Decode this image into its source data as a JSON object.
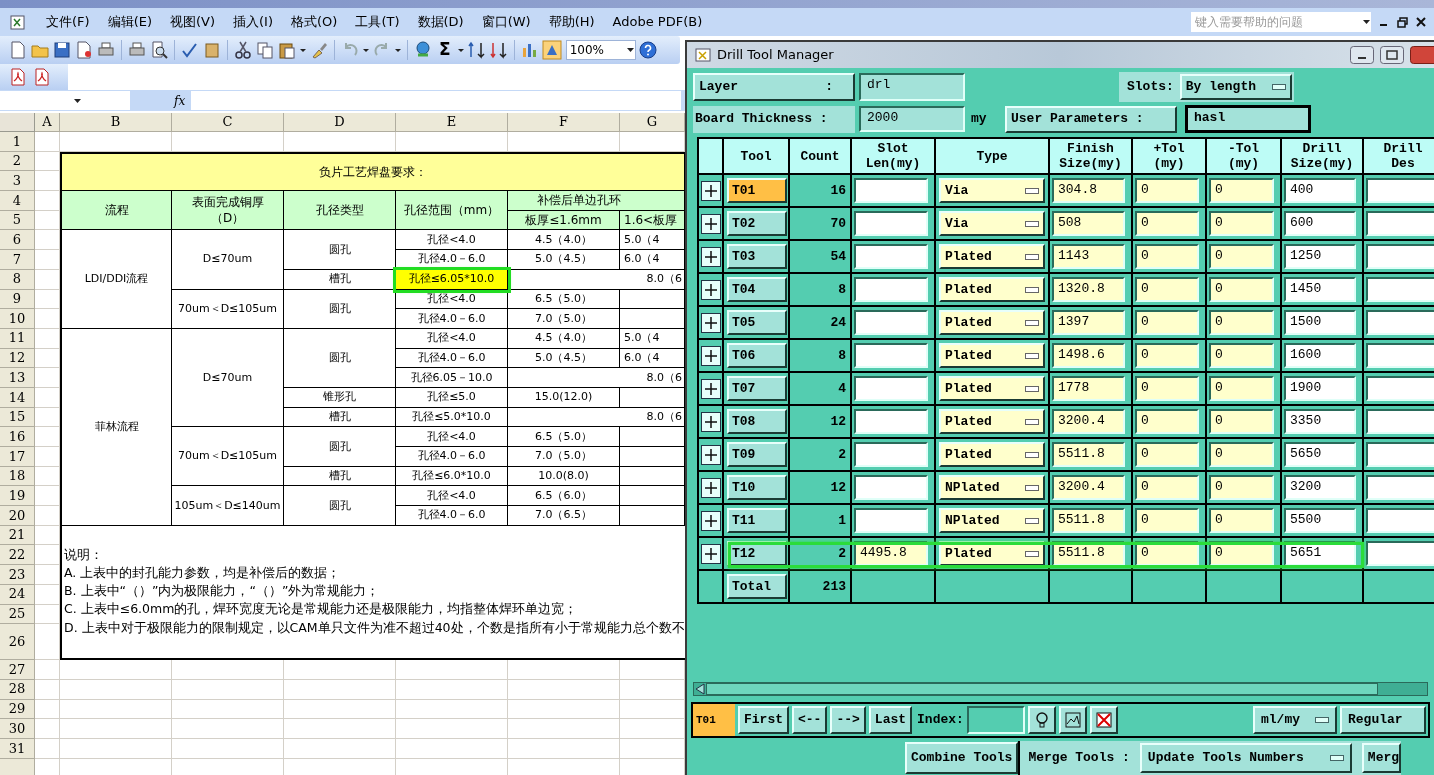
{
  "excel": {
    "menu": [
      "文件(F)",
      "编辑(E)",
      "视图(V)",
      "插入(I)",
      "格式(O)",
      "工具(T)",
      "数据(D)",
      "窗口(W)",
      "帮助(H)",
      "Adobe PDF(B)"
    ],
    "help_placeholder": "键入需要帮助的问题",
    "sigma": "Σ",
    "zoom": "100%",
    "formula_label": "fx",
    "column_headers": [
      "A",
      "B",
      "C",
      "D",
      "E",
      "F",
      "G"
    ],
    "row_headers": [
      "1",
      "2",
      "3",
      "4",
      "5",
      "6",
      "7",
      "8",
      "9",
      "10",
      "11",
      "12",
      "13",
      "14",
      "15",
      "16",
      "17",
      "18",
      "19",
      "20",
      "21",
      "22",
      "23",
      "24",
      "25",
      "26",
      "27",
      "28",
      "29",
      "30",
      "31"
    ],
    "cells": [
      {
        "text": "负片工艺焊盘要求：",
        "highlighted": false
      },
      {
        "text": "流程",
        "highlighted": false
      },
      {
        "text": "表面完成铜厚（D）",
        "highlighted": false
      },
      {
        "text": "孔径类型",
        "highlighted": false
      },
      {
        "text": "孔径范围（mm）",
        "highlighted": false
      },
      {
        "text": "补偿后单边孔环",
        "highlighted": false
      },
      {
        "text": "板厚≤1.6mm",
        "highlighted": false
      },
      {
        "text": "1.6<板厚",
        "highlighted": false
      },
      {
        "text": "LDI/DDI流程",
        "highlighted": false
      },
      {
        "text": "D≤70um",
        "highlighted": false
      },
      {
        "text": "圆孔",
        "highlighted": false
      },
      {
        "text": "孔径<4.0",
        "highlighted": false
      },
      {
        "text": "4.5（4.0）",
        "highlighted": false
      },
      {
        "text": "5.0（4",
        "highlighted": false
      },
      {
        "text": "孔径4.0－6.0",
        "highlighted": false
      },
      {
        "text": "5.0（4.5）",
        "highlighted": false
      },
      {
        "text": "6.0（4",
        "highlighted": false
      },
      {
        "text": "槽孔",
        "highlighted": false
      },
      {
        "text": "孔径≤6.05*10.0",
        "highlighted": true
      },
      {
        "text": "8.0（6",
        "highlighted": false
      },
      {
        "text": "70um＜D≤105um",
        "highlighted": false
      },
      {
        "text": "圆孔",
        "highlighted": false
      },
      {
        "text": "孔径<4.0",
        "highlighted": false
      },
      {
        "text": "6.5（5.0）",
        "highlighted": false
      },
      {
        "text": "孔径4.0－6.0",
        "highlighted": false
      },
      {
        "text": "7.0（5.0）",
        "highlighted": false
      },
      {
        "text": "菲林流程",
        "highlighted": false
      },
      {
        "text": "D≤70um",
        "highlighted": false
      },
      {
        "text": "圆孔",
        "highlighted": false
      },
      {
        "text": "孔径<4.0",
        "highlighted": false
      },
      {
        "text": "4.5（4.0）",
        "highlighted": false
      },
      {
        "text": "5.0（4",
        "highlighted": false
      },
      {
        "text": "孔径4.0－6.0",
        "highlighted": false
      },
      {
        "text": "5.0（4.5）",
        "highlighted": false
      },
      {
        "text": "6.0（4",
        "highlighted": false
      },
      {
        "text": "孔径6.05－10.0",
        "highlighted": false
      },
      {
        "text": "8.0（6",
        "highlighted": false
      },
      {
        "text": "锥形孔",
        "highlighted": false
      },
      {
        "text": "孔径≤5.0",
        "highlighted": false
      },
      {
        "text": "15.0(12.0)",
        "highlighted": false
      },
      {
        "text": "槽孔",
        "highlighted": false
      },
      {
        "text": "孔径≤5.0*10.0",
        "highlighted": false
      },
      {
        "text": "8.0（6",
        "highlighted": false
      },
      {
        "text": "70um＜D≤105um",
        "highlighted": false
      },
      {
        "text": "圆孔",
        "highlighted": false
      },
      {
        "text": "孔径<4.0",
        "highlighted": false
      },
      {
        "text": "6.5（5.0）",
        "highlighted": false
      },
      {
        "text": "孔径4.0－6.0",
        "highlighted": false
      },
      {
        "text": "7.0（5.0）",
        "highlighted": false
      },
      {
        "text": "槽孔",
        "highlighted": false
      },
      {
        "text": "孔径≤6.0*10.0",
        "highlighted": false
      },
      {
        "text": "10.0(8.0)",
        "highlighted": false
      },
      {
        "text": "105um＜D≤140um",
        "highlighted": false
      },
      {
        "text": "圆孔",
        "highlighted": false
      },
      {
        "text": "孔径<4.0",
        "highlighted": false
      },
      {
        "text": "6.5（6.0）",
        "highlighted": false
      },
      {
        "text": "孔径4.0－6.0",
        "highlighted": false
      },
      {
        "text": "7.0（6.5）",
        "highlighted": false
      }
    ],
    "notes": [
      "说明：",
      "A.  上表中的封孔能力参数，均是补偿后的数据；",
      "B.  上表中“（）”内为极限能力，“（）”外为常规能力；",
      "C.  上表中≤6.0mm的孔，焊环宽度无论是常规能力还是极限能力，均指整体焊环单边宽；",
      "D.  上表中对于极限能力的限制规定，以CAM单只文件为准不超过40处，个数是指所有小于常规能力总个数不"
    ]
  },
  "drill_tool_manager": {
    "title": "Drill Tool Manager",
    "layer_label": "Layer",
    "layer_colon": ":",
    "layer_value": "drl",
    "slots_label": "Slots:",
    "slots_value": "By length",
    "thickness_label": "Board Thickness :",
    "thickness_value": "2000",
    "thickness_unit": "my",
    "user_params_button": "User Parameters :",
    "user_params_value": "hasl",
    "columns": [
      "Tool",
      "Count",
      "Slot\nLen(my)",
      "Type",
      "Finish\nSize(my)",
      "+Tol\n(my)",
      "-Tol\n(my)",
      "Drill\nSize(my)",
      "Drill\nDes"
    ],
    "rows": [
      {
        "tool": "T01",
        "selected": true,
        "count": "16",
        "type": "Via",
        "finish": "304.8",
        "plus_tol": "0",
        "minus_tol": "0",
        "drill_size": "400",
        "highlighted": false
      },
      {
        "tool": "T02",
        "selected": false,
        "count": "70",
        "type": "Via",
        "finish": "508",
        "plus_tol": "0",
        "minus_tol": "0",
        "drill_size": "600",
        "highlighted": false
      },
      {
        "tool": "T03",
        "selected": false,
        "count": "54",
        "type": "Plated",
        "finish": "1143",
        "plus_tol": "0",
        "minus_tol": "0",
        "drill_size": "1250",
        "highlighted": false
      },
      {
        "tool": "T04",
        "selected": false,
        "count": "8",
        "type": "Plated",
        "finish": "1320.8",
        "plus_tol": "0",
        "minus_tol": "0",
        "drill_size": "1450",
        "highlighted": false
      },
      {
        "tool": "T05",
        "selected": false,
        "count": "24",
        "type": "Plated",
        "finish": "1397",
        "plus_tol": "0",
        "minus_tol": "0",
        "drill_size": "1500",
        "highlighted": false
      },
      {
        "tool": "T06",
        "selected": false,
        "count": "8",
        "type": "Plated",
        "finish": "1498.6",
        "plus_tol": "0",
        "minus_tol": "0",
        "drill_size": "1600",
        "highlighted": false
      },
      {
        "tool": "T07",
        "selected": false,
        "count": "4",
        "type": "Plated",
        "finish": "1778",
        "plus_tol": "0",
        "minus_tol": "0",
        "drill_size": "1900",
        "highlighted": false
      },
      {
        "tool": "T08",
        "selected": false,
        "count": "12",
        "type": "Plated",
        "finish": "3200.4",
        "plus_tol": "0",
        "minus_tol": "0",
        "drill_size": "3350",
        "highlighted": false
      },
      {
        "tool": "T09",
        "selected": false,
        "count": "2",
        "type": "Plated",
        "finish": "5511.8",
        "plus_tol": "0",
        "minus_tol": "0",
        "drill_size": "5650",
        "highlighted": false
      },
      {
        "tool": "T10",
        "selected": false,
        "count": "12",
        "type": "NPlated",
        "finish": "3200.4",
        "plus_tol": "0",
        "minus_tol": "0",
        "drill_size": "3200",
        "highlighted": false
      },
      {
        "tool": "T11",
        "selected": false,
        "count": "1",
        "type": "NPlated",
        "finish": "5511.8",
        "plus_tol": "0",
        "minus_tol": "0",
        "drill_size": "5500",
        "highlighted": false
      },
      {
        "tool": "T12",
        "selected": false,
        "count": "2",
        "slot_len": "4495.8",
        "type": "Plated",
        "finish": "5511.8",
        "plus_tol": "0",
        "minus_tol": "0",
        "drill_size": "5651",
        "highlighted": true
      }
    ],
    "total_label": "Total",
    "total": "213",
    "current_tool": "T01",
    "nav_buttons": [
      "First",
      "<--",
      "-->",
      "Last"
    ],
    "index_label": "Index:",
    "units": "ml/my",
    "mode": "Regular",
    "combine_button": "Combine Tools",
    "merge_label": "Merge Tools :",
    "merge_option": "Update Tools Numbers",
    "merge_button": "Merg"
  }
}
